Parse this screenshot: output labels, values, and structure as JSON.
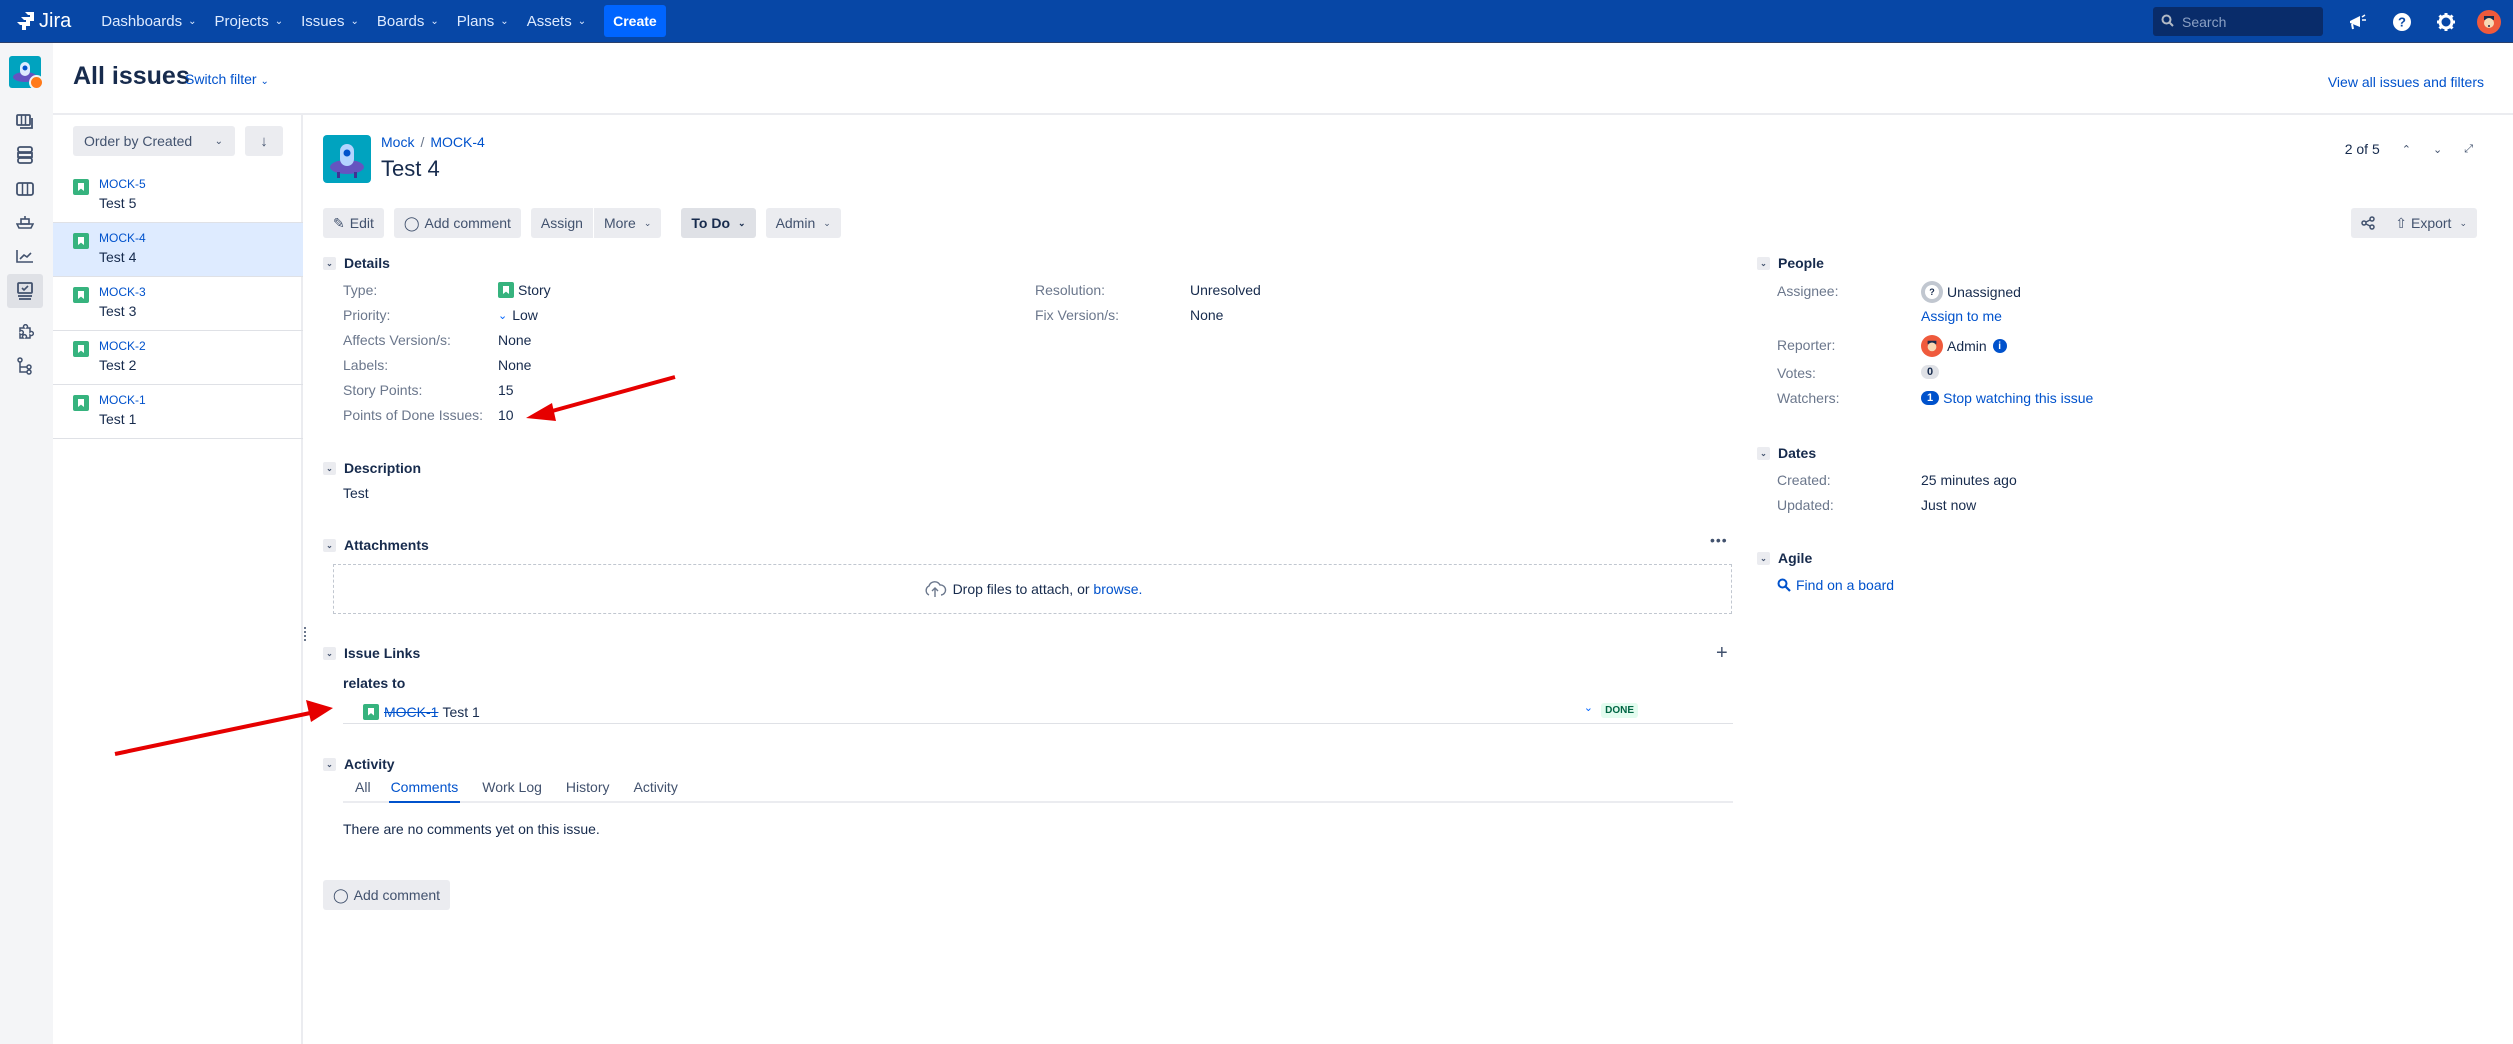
{
  "topnav": {
    "logo": "Jira",
    "items": [
      {
        "label": "Dashboards"
      },
      {
        "label": "Projects"
      },
      {
        "label": "Issues"
      },
      {
        "label": "Boards"
      },
      {
        "label": "Plans"
      },
      {
        "label": "Assets"
      }
    ],
    "create_label": "Create",
    "search_placeholder": "Search",
    "icons": [
      "notifications-icon",
      "help-icon",
      "settings-icon",
      "profile-avatar"
    ]
  },
  "sidebar": {
    "icons": [
      "board-icon",
      "backlog-icon",
      "columns-icon",
      "releases-icon",
      "reports-icon",
      "issues-icon",
      "components-icon",
      "code-icon"
    ],
    "active_index": 5
  },
  "header": {
    "title": "All issues",
    "switch_filter": "Switch filter",
    "view_all": "View all issues and filters"
  },
  "issue_list": {
    "order_label": "Order by Created",
    "items": [
      {
        "key": "MOCK-5",
        "summary": "Test 5",
        "selected": false
      },
      {
        "key": "MOCK-4",
        "summary": "Test 4",
        "selected": true
      },
      {
        "key": "MOCK-3",
        "summary": "Test 3",
        "selected": false
      },
      {
        "key": "MOCK-2",
        "summary": "Test 2",
        "selected": false
      },
      {
        "key": "MOCK-1",
        "summary": "Test 1",
        "selected": false
      }
    ]
  },
  "issue": {
    "project": "Mock",
    "key": "MOCK-4",
    "title": "Test 4",
    "pager": "2 of 5",
    "toolbar": {
      "edit": "Edit",
      "add_comment": "Add comment",
      "assign": "Assign",
      "more": "More",
      "status": "To Do",
      "admin": "Admin",
      "export": "Export"
    },
    "details": {
      "title": "Details",
      "left": [
        {
          "label": "Type:",
          "value": "Story"
        },
        {
          "label": "Priority:",
          "value": "Low"
        },
        {
          "label": "Affects Version/s:",
          "value": "None"
        },
        {
          "label": "Labels:",
          "value": "None"
        },
        {
          "label": "Story Points:",
          "value": "15"
        },
        {
          "label": "Points of Done Issues:",
          "value": "10"
        }
      ],
      "right": [
        {
          "label": "Resolution:",
          "value": "Unresolved"
        },
        {
          "label": "Fix Version/s:",
          "value": "None"
        }
      ]
    },
    "description": {
      "title": "Description",
      "text": "Test"
    },
    "attachments": {
      "title": "Attachments",
      "drop_text": "Drop files to attach, or ",
      "browse": "browse."
    },
    "links": {
      "title": "Issue Links",
      "relation": "relates to",
      "items": [
        {
          "key": "MOCK-1",
          "summary": "Test 1",
          "status": "DONE",
          "priority": "Low"
        }
      ]
    },
    "activity": {
      "title": "Activity",
      "tabs": [
        "All",
        "Comments",
        "Work Log",
        "History",
        "Activity"
      ],
      "active_tab": "Comments",
      "empty_text": "There are no comments yet on this issue.",
      "add_comment": "Add comment"
    },
    "people": {
      "title": "People",
      "assignee_label": "Assignee:",
      "assignee": "Unassigned",
      "assign_to_me": "Assign to me",
      "reporter_label": "Reporter:",
      "reporter": "Admin",
      "votes_label": "Votes:",
      "votes": "0",
      "watchers_label": "Watchers:",
      "watchers": "1",
      "watch_action": "Stop watching this issue"
    },
    "dates": {
      "title": "Dates",
      "created_label": "Created:",
      "created": "25 minutes ago",
      "updated_label": "Updated:",
      "updated": "Just now"
    },
    "agile": {
      "title": "Agile",
      "find_on_board": "Find on a board"
    }
  },
  "annotations": {
    "arrow_color": "#e60000"
  }
}
